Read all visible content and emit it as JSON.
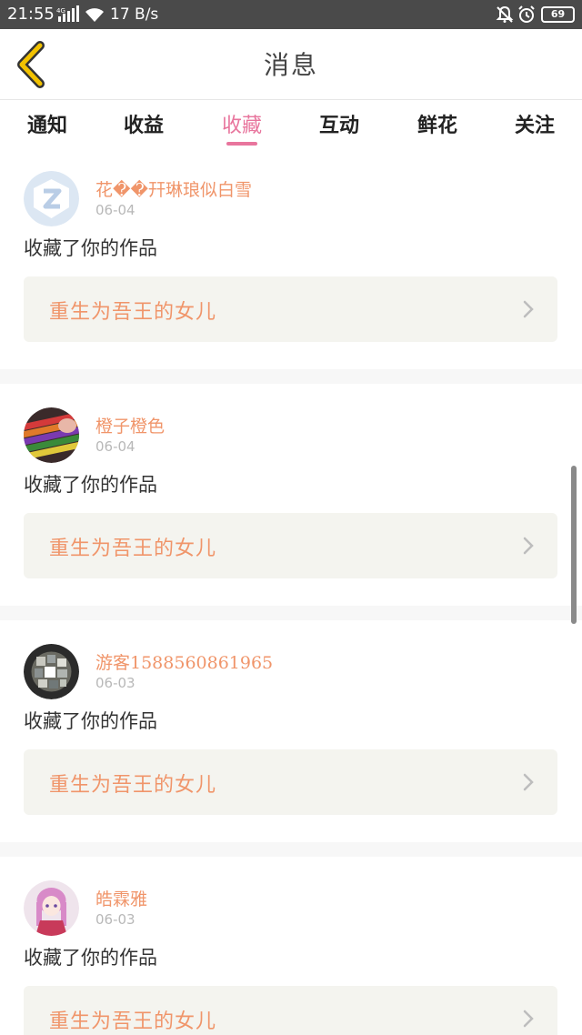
{
  "status_bar": {
    "time": "21:55",
    "network": "4G",
    "speed": "17 B/s",
    "battery": "69"
  },
  "header": {
    "title": "消息",
    "back_icon": "chevron-left-icon",
    "back_color": "#f2c200"
  },
  "tabs": [
    {
      "label": "通知",
      "active": false
    },
    {
      "label": "收益",
      "active": false
    },
    {
      "label": "收藏",
      "active": true
    },
    {
      "label": "互动",
      "active": false
    },
    {
      "label": "鲜花",
      "active": false
    },
    {
      "label": "关注",
      "active": false
    }
  ],
  "colors": {
    "accent": "#e8759d",
    "username": "#f0956a",
    "work_box": "#f4f4ef"
  },
  "notifications": [
    {
      "username": "花��幵琳琅似白雪",
      "date": "06-04",
      "action": "收藏了你的作品",
      "work_title": "重生为吾王的女儿",
      "avatar": "qq-default-avatar"
    },
    {
      "username": "橙子橙色",
      "date": "06-04",
      "action": "收藏了你的作品",
      "work_title": "重生为吾王的女儿",
      "avatar": "colored-pencils-avatar"
    },
    {
      "username": "游客1588560861965",
      "date": "06-03",
      "action": "收藏了你的作品",
      "work_title": "重生为吾王的女儿",
      "avatar": "mosaic-avatar"
    },
    {
      "username": "皓霖雅",
      "date": "06-03",
      "action": "收藏了你的作品",
      "work_title": "重生为吾王的女儿",
      "avatar": "anime-girl-avatar"
    }
  ]
}
